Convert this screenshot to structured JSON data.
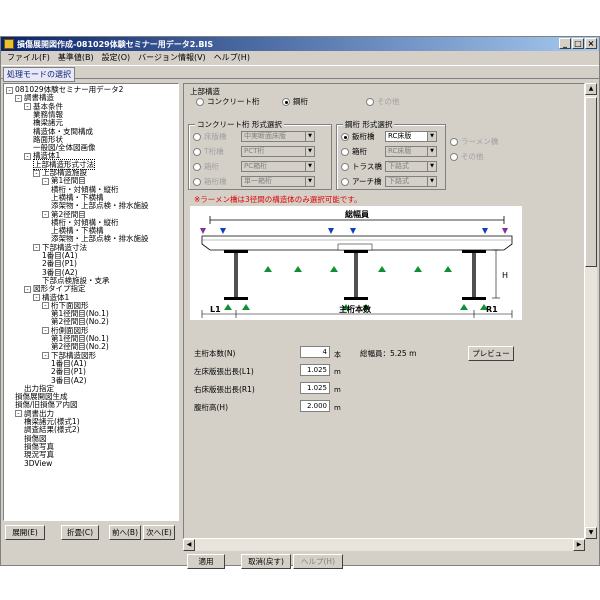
{
  "window": {
    "title": "損傷展開図作成-081029体験セミナー用データ2.BIS",
    "controls": [
      "_",
      "□",
      "×"
    ]
  },
  "menu": [
    "ファイル(F)",
    "基準値(B)",
    "設定(O)",
    "バージョン情報(V)",
    "ヘルプ(H)"
  ],
  "mode_tab": "処理モードの選択",
  "tree": [
    {
      "label": "081029体験セミナー用データ2",
      "toggle": "-"
    },
    {
      "label": "調書構造",
      "toggle": "-"
    },
    {
      "label": "基本条件",
      "toggle": "-"
    },
    {
      "label": "業務情報",
      "toggle": ""
    },
    {
      "label": "橋梁諸元",
      "toggle": ""
    },
    {
      "label": "構造体・支間構成",
      "toggle": ""
    },
    {
      "label": "路面形状",
      "toggle": ""
    },
    {
      "label": "一般図/全体図画像",
      "toggle": ""
    },
    {
      "label": "構造体1",
      "toggle": "-"
    },
    {
      "label": "上部構造形式寸法",
      "toggle": "",
      "selected": true
    },
    {
      "label": "上部構造施設",
      "toggle": "-"
    },
    {
      "label": "第1径間目",
      "toggle": "-"
    },
    {
      "label": "横桁・対傾構・縦桁",
      "toggle": ""
    },
    {
      "label": "上横構・下横構",
      "toggle": ""
    },
    {
      "label": "添架物・上部点検・排水施設",
      "toggle": ""
    },
    {
      "label": "第2径間目",
      "toggle": "-"
    },
    {
      "label": "横桁・対傾構・縦桁",
      "toggle": ""
    },
    {
      "label": "上横構・下横構",
      "toggle": ""
    },
    {
      "label": "添架物・上部点検・排水施設",
      "toggle": ""
    },
    {
      "label": "下部構造寸法",
      "toggle": "-"
    },
    {
      "label": "1番目(A1)",
      "toggle": ""
    },
    {
      "label": "2番目(P1)",
      "toggle": ""
    },
    {
      "label": "3番目(A2)",
      "toggle": ""
    },
    {
      "label": "下部点検施設・支承",
      "toggle": ""
    },
    {
      "label": "図形タイプ指定",
      "toggle": "-"
    },
    {
      "label": "構造体1",
      "toggle": "-"
    },
    {
      "label": "桁下面図形",
      "toggle": "-"
    },
    {
      "label": "第1径間目(No.1)",
      "toggle": ""
    },
    {
      "label": "第2径間目(No.2)",
      "toggle": ""
    },
    {
      "label": "桁側面図形",
      "toggle": "-"
    },
    {
      "label": "第1径間目(No.1)",
      "toggle": ""
    },
    {
      "label": "第2径間目(No.2)",
      "toggle": ""
    },
    {
      "label": "下部構造図形",
      "toggle": "-"
    },
    {
      "label": "1番目(A1)",
      "toggle": ""
    },
    {
      "label": "2番目(P1)",
      "toggle": ""
    },
    {
      "label": "3番目(A2)",
      "toggle": ""
    },
    {
      "label": "出力指定",
      "toggle": ""
    },
    {
      "label": "損傷展開図生成",
      "toggle": ""
    },
    {
      "label": "損傷/旧損傷ア内図",
      "toggle": ""
    },
    {
      "label": "調書出力",
      "toggle": "-"
    },
    {
      "label": "橋梁諸元(様式1)",
      "toggle": ""
    },
    {
      "label": "調査結果(様式2)",
      "toggle": ""
    },
    {
      "label": "損傷図",
      "toggle": ""
    },
    {
      "label": "損傷写真",
      "toggle": ""
    },
    {
      "label": "現況写真",
      "toggle": ""
    },
    {
      "label": "3DView",
      "toggle": ""
    }
  ],
  "tree_buttons": {
    "expand": "展開(E)",
    "collapse": "折畳(C)",
    "prev": "前へ(B)",
    "next": "次へ(E)"
  },
  "superstructure": {
    "title": "上部構造",
    "options": [
      {
        "label": "コンクリート桁",
        "checked": false,
        "disabled": false
      },
      {
        "label": "鋼桁",
        "checked": true,
        "disabled": false
      },
      {
        "label": "その他",
        "checked": false,
        "disabled": true
      }
    ]
  },
  "concrete_types": {
    "title": "コンクリート桁 形式選択",
    "rows": [
      {
        "label": "床版橋",
        "value": "中実断面床版"
      },
      {
        "label": "T桁橋",
        "value": "PCT桁"
      },
      {
        "label": "箱桁",
        "value": "PC箱桁"
      },
      {
        "label": "箱桁橋",
        "value": "単一箱桁"
      }
    ]
  },
  "steel_types": {
    "title": "鋼桁 形式選択",
    "rows": [
      {
        "label": "鈑桁橋",
        "value": "RC床版",
        "checked": true
      },
      {
        "label": "箱桁",
        "value": "RC床版",
        "checked": false
      },
      {
        "label": "トラス橋",
        "value": "下路式",
        "checked": false
      },
      {
        "label": "アーチ橋",
        "value": "下路式",
        "checked": false
      }
    ],
    "extra": [
      {
        "label": "ラーメン橋"
      },
      {
        "label": "その他"
      }
    ]
  },
  "warning": "※ラーメン橋は3径間の構造体のみ選択可能です。",
  "diagram": {
    "total_width_label": "総幅員",
    "l1": "L1",
    "r1": "R1",
    "girder_count_label": "主桁本数",
    "h": "H"
  },
  "fields": {
    "girder_count": {
      "label": "主桁本数(N)",
      "value": "4",
      "unit": "本"
    },
    "total_width": {
      "label": "総幅員：5.25 m"
    },
    "left_overhang": {
      "label": "左床版張出長(L1)",
      "value": "1.025",
      "unit": "m"
    },
    "right_overhang": {
      "label": "右床版張出長(R1)",
      "value": "1.025",
      "unit": "m"
    },
    "girder_height": {
      "label": "腹桁高(H)",
      "value": "2.000",
      "unit": "m"
    }
  },
  "preview_button": "プレビュー",
  "action_buttons": {
    "apply": "適用",
    "cancel": "取消(戻す)",
    "help": "ヘルプ(H)"
  },
  "colors": {
    "title_start": "#0a246a",
    "warning": "#e00000",
    "bearing_green": "#109030",
    "load_blue": "#1040c0",
    "load_purple": "#8030a0"
  }
}
